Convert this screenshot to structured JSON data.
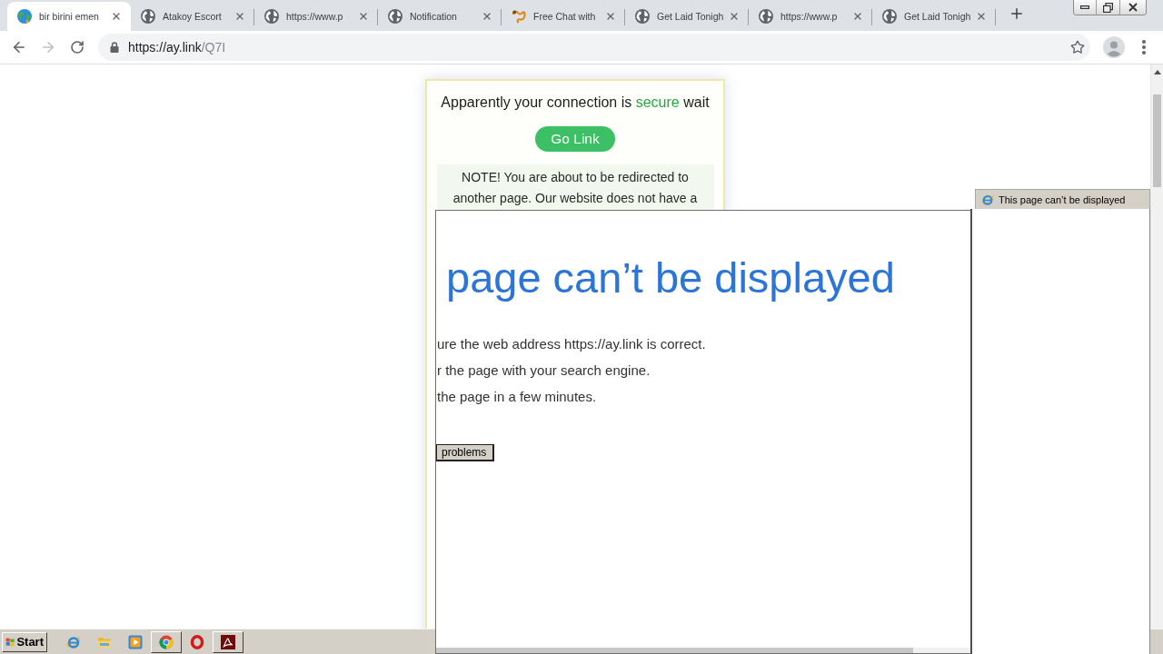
{
  "browser": {
    "tabs": [
      {
        "title": "bir birini emen",
        "kind": "earth",
        "selected": true
      },
      {
        "title": "Atakoy Escort",
        "kind": "globe",
        "selected": false
      },
      {
        "title": "https://www.p",
        "kind": "globe",
        "selected": false
      },
      {
        "title": "Notification",
        "kind": "globe",
        "selected": false
      },
      {
        "title": "Free Chat with",
        "kind": "chat",
        "selected": false
      },
      {
        "title": "Get Laid Tonigh",
        "kind": "globe",
        "selected": false
      },
      {
        "title": "https://www.p",
        "kind": "globe",
        "selected": false
      },
      {
        "title": "Get Laid Tonigh",
        "kind": "globe",
        "selected": false
      }
    ],
    "toolbar": {
      "back_disabled": false,
      "forward_disabled": true,
      "url": {
        "host": "https://ay.link",
        "path": "/Q7I"
      }
    }
  },
  "page": {
    "headline": [
      {
        "text": "Apparently your connection is",
        "accent": false
      },
      {
        "text": "secure",
        "accent": true
      },
      {
        "text": "wait",
        "accent": false
      }
    ],
    "button": "Go Link",
    "note": "NOTE! You are about to be redirected to another page. Our website does not have a"
  },
  "error_window": {
    "heading": "page can’t be displayed",
    "lines": [
      "ure the web address https://ay.link is correct.",
      "r the page with your search engine.",
      "the page in a few minutes."
    ],
    "button": "problems"
  },
  "side_window": {
    "title": "This page can’t be displayed"
  },
  "taskbar": {
    "start": "Start",
    "apps": [
      {
        "running": false
      },
      {
        "running": false
      },
      {
        "running": false
      },
      {
        "running": true
      },
      {
        "running": false
      },
      {
        "running": true
      }
    ]
  }
}
